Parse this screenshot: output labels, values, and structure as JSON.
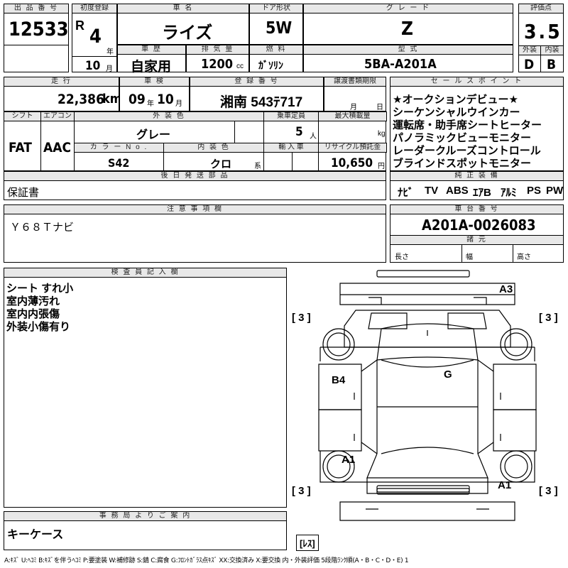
{
  "header_labels": {
    "lot_no": "出 品 番 号",
    "first_reg": "初度登録",
    "car_name": "車 名",
    "door": "ドア形状",
    "grade": "グ レ ー ド",
    "score": "評価点",
    "history": "車 歴",
    "displacement": "排 気 量",
    "fuel": "燃 料",
    "model": "型 式",
    "exterior": "外装",
    "interior": "内装",
    "mileage": "走 行",
    "inspection": "車 検",
    "registration": "登 録 番 号",
    "transfer": "譲渡書類期限",
    "sales_points": "セ ー ル ス ポ イ ン ト",
    "shift": "シフト",
    "aircon": "エアコン",
    "ext_color": "外 装 色",
    "capacity": "乗車定員",
    "max_load": "最大積載量",
    "color_no": "カ ラ ー N o .",
    "int_color": "内 装 色",
    "import": "輸 入 車",
    "recycle": "リサイクル預託金",
    "later_parts": "後 日 発 送 部 品",
    "factory_equip": "純 正 装 備",
    "notes": "注 意 事 項 欄",
    "chassis": "車 台 番 号",
    "specs": "諸 元",
    "inspector": "検 査 員 記 入 欄",
    "office": "事 務 局 よ り ご 案 内"
  },
  "values": {
    "lot_no": "12533",
    "era": "R",
    "year": "4",
    "year_unit": "年",
    "month": "10",
    "month_unit": "月",
    "car_name": "ライズ",
    "door": "5W",
    "grade": "Z",
    "score": "3.5",
    "history": "自家用",
    "displacement": "1200",
    "displacement_unit": "cc",
    "fuel": "ｶﾞｿﾘﾝ",
    "model": "5BA-A201A",
    "exterior": "D",
    "interior": "B",
    "mileage": "22,386",
    "mileage_unit": "km",
    "insp_year": "09",
    "insp_year_unit": "年",
    "insp_month": "10",
    "insp_month_unit": "月",
    "registration": "湘南 543ﾃ717",
    "transfer_month": "月",
    "transfer_day": "日",
    "shift": "FAT",
    "aircon": "AAC",
    "ext_color": "グレー",
    "capacity": "5",
    "capacity_unit": "人",
    "max_load_unit": "kg",
    "color_no": "S42",
    "int_color": "クロ",
    "int_color_unit": "系",
    "recycle": "10,650",
    "recycle_unit": "円",
    "later_parts": "保証書",
    "notes": "Ｙ６８Ｔナビ",
    "chassis": "A201A-0026083",
    "spec_length": "長さ",
    "spec_width": "幅",
    "spec_height": "高さ",
    "office": "キーケース",
    "legend": "A:ｷｽﾞ U:ﾍｺﾐ B:ｷｽﾞを伴うﾍｺﾐ P:要塗装 W:補修跡 S:錆 C:腐食 G:ﾌﾛﾝﾄｶﾞﾗｽ点ｷｽﾞ XX:交換済み X:要交換  内・外装評価 5段階ﾗﾝｸ順(A・B・C・D・E) 1"
  },
  "sales_points": [
    "★オークションデビュー★",
    "シーケンシャルウインカー",
    "運転席・助手席シートヒーター",
    "パノラミックビューモニター",
    "レーダークルーズコントロール",
    "ブラインドスポットモニター"
  ],
  "equipment": [
    "ﾅﾋﾞ",
    "TV",
    "ABS",
    "ｴｱB",
    "ｱﾙﾐ",
    "PS",
    "PW"
  ],
  "inspector_notes": [
    "シート すれ小",
    "室内薄汚れ",
    "室内内張傷",
    "外装小傷有り"
  ],
  "diagram_marks": {
    "rear_panel": "A3",
    "glass": "G",
    "left_door": "B4",
    "left_front": "A1",
    "right_front": "A1",
    "tire_rear_left": "[ 3 ]",
    "tire_rear_right": "[ 3 ]",
    "tire_front_left": "[ 3 ]",
    "tire_front_right": "[ 3 ]",
    "spare": "[ﾚｽ]"
  }
}
